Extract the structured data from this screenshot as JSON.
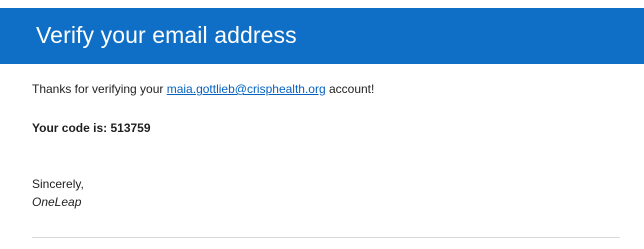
{
  "header": {
    "title": "Verify your email address"
  },
  "message": {
    "intro_prefix": "Thanks for verifying your ",
    "email": "maia.gottlieb@crisphealth.org",
    "intro_suffix": " account!",
    "code_label": "Your code is: ",
    "code_value": "513759",
    "closing": "Sincerely,",
    "signature": "OneLeap"
  },
  "colors": {
    "header_background": "#0f6fc6",
    "link": "#0563c1"
  }
}
